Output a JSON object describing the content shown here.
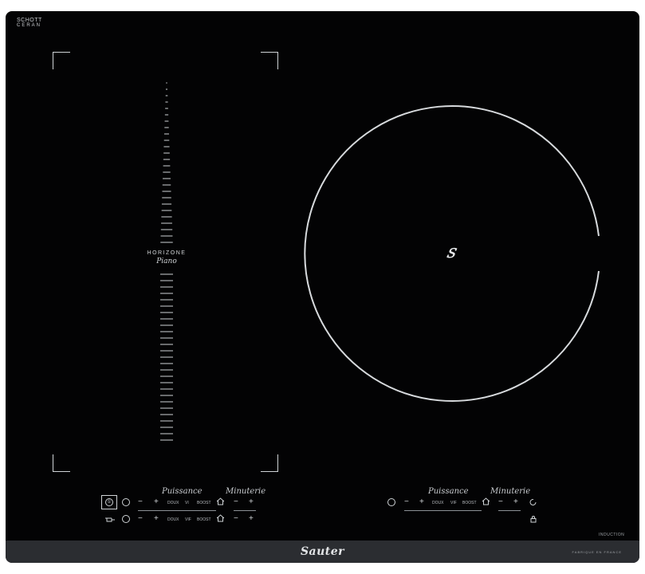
{
  "brand": {
    "line1": "SCHOTT",
    "line2": "CERAN"
  },
  "horizone": {
    "label": "HORIZONE",
    "script": "Piano"
  },
  "zone2": {
    "center_mark": "𝑆"
  },
  "left_panel": {
    "puissance_title": "Puissance",
    "minuterie_title": "Minuterie",
    "row1": {
      "power_icon": "①",
      "minus": "−",
      "plus": "+",
      "doux": "DOUX",
      "vi": "VI",
      "boost": "BOOST",
      "t_minus": "−",
      "t_plus": "+"
    },
    "row2": {
      "minus": "−",
      "plus": "+",
      "doux": "DOUX",
      "vif": "VIF",
      "boost": "BOOST",
      "t_minus": "−",
      "t_plus": "+"
    }
  },
  "right_panel": {
    "puissance_title": "Puissance",
    "minuterie_title": "Minuterie",
    "minus": "−",
    "plus": "+",
    "doux": "DOUX",
    "vif": "VIF",
    "boost": "BOOST",
    "t_minus": "−",
    "t_plus": "+"
  },
  "induction_label": "INDUCTION",
  "footer": {
    "logo": "Sauter",
    "made_in": "FABRIQUE EN FRANCE"
  }
}
